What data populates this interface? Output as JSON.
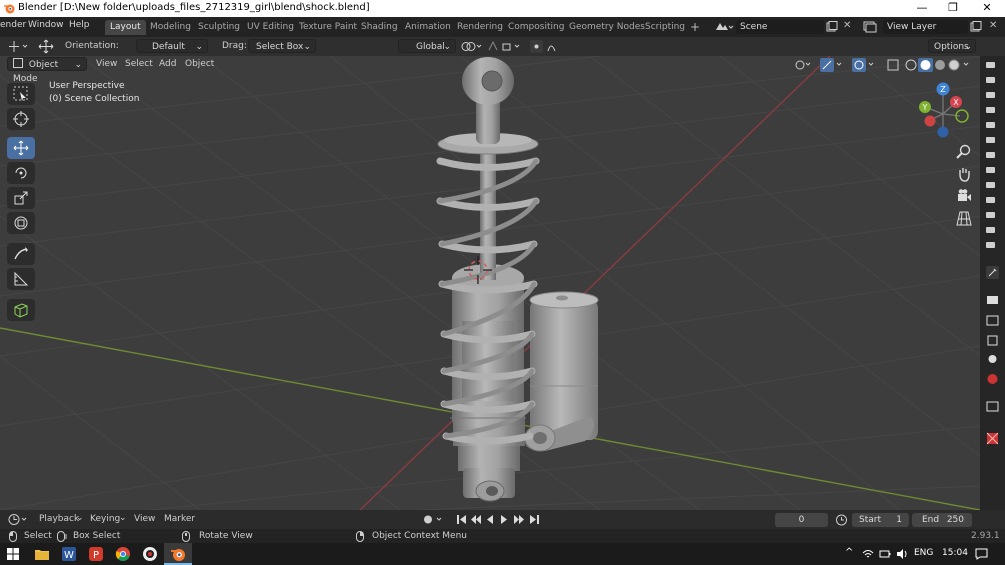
{
  "window": {
    "title": "Blender [D:\\New folder\\uploads_files_2712319_girl\\blend\\shock.blend]",
    "minimize": "—",
    "maximize": "❐",
    "close": "✕"
  },
  "topbar": {
    "menus": [
      "ender",
      "Window",
      "Help"
    ],
    "workspaces": [
      "Layout",
      "Modeling",
      "Sculpting",
      "UV Editing",
      "Texture Paint",
      "Shading",
      "Animation",
      "Rendering",
      "Compositing",
      "Geometry Nodes",
      "Scripting"
    ],
    "add_workspace": "+",
    "scene": "Scene",
    "view_layer": "View Layer"
  },
  "tool_header": {
    "orientation_label": "Orientation:",
    "orientation_value": "Default",
    "drag_label": "Drag:",
    "drag_value": "Select Box",
    "transform_value": "Global",
    "options": "Options"
  },
  "viewport_header": {
    "mode": "Object Mode",
    "menus": [
      "View",
      "Select",
      "Add",
      "Object"
    ]
  },
  "viewport": {
    "overlay_title": "User Perspective",
    "overlay_collection": "(0) Scene Collection",
    "gizmo_axes": [
      "Z",
      "Y",
      "X"
    ]
  },
  "timeline": {
    "menus": [
      "Playback",
      "Keying",
      "View",
      "Marker"
    ],
    "current_frame": "0",
    "start_label": "Start",
    "start_value": "1",
    "end_label": "End",
    "end_value": "250"
  },
  "statusbar": {
    "select": "Select",
    "box_select": "Box Select",
    "rotate_view": "Rotate View",
    "context_menu": "Object Context Menu",
    "version": "2.93.1"
  },
  "taskbar": {
    "language": "ENG",
    "time": "15:04"
  },
  "colors": {
    "active_tool": "#4a6fa3",
    "axis_x": "#d8434f",
    "axis_y": "#7fb22d",
    "axis_z": "#3f85d6",
    "model": "#9a9a9a"
  }
}
